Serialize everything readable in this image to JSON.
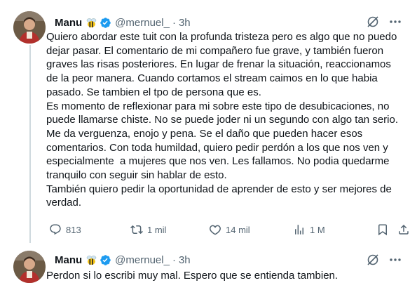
{
  "colors": {
    "text": "#0f1419",
    "muted": "#536471",
    "verified": "#1d9bf0",
    "thread_line": "#cfd9de"
  },
  "tweets": [
    {
      "author": {
        "name": "Manu",
        "emoji": "bee-emoji",
        "handle": "@mernuel_",
        "time": "3h"
      },
      "text": "Quiero abordar este tuit con la profunda tristeza pero es algo que no puedo\ndejar pasar. El comentario de mi compañero fue grave, y también fueron\ngraves las risas posteriores. En lugar de frenar la situación, reaccionamos\nde la peor manera. Cuando cortamos el stream caimos en lo que habia\npasado. Se tambien el tpo de persona que es.\nEs momento de reflexionar para mi sobre este tipo de desubicaciones, no\npuede llamarse chiste. No se puede joder ni un segundo con algo tan serio.\nMe da verguenza, enojo y pena. Se el daño que pueden hacer esos\ncomentarios. Con toda humildad, quiero pedir perdón a los que nos ven y\nespecialmente  a mujeres que nos ven. Les fallamos. No podia quedarme\ntranquilo con seguir sin hablar de esto.\nTambién quiero pedir la oportunidad de aprender de esto y ser mejores de\nverdad.",
      "stats": {
        "replies": "813",
        "reposts": "1 mil",
        "likes": "14 mil",
        "views": "1 M"
      }
    },
    {
      "author": {
        "name": "Manu",
        "emoji": "bee-emoji",
        "handle": "@mernuel_",
        "time": "3h"
      },
      "text": "Perdon si lo escribi muy mal. Espero que se entienda tambien."
    }
  ]
}
